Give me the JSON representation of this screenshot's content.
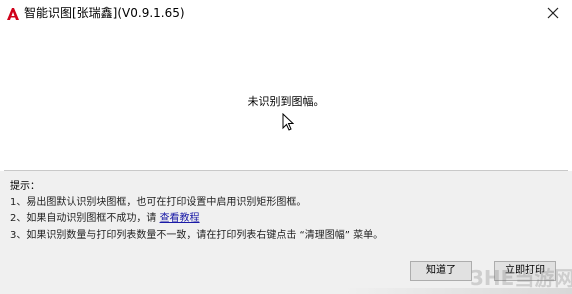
{
  "window": {
    "title": "智能识图[张瑞鑫](V0.9.1.65)",
    "icon": "autocad-logo-icon",
    "close_icon": "close-icon",
    "accent": "#d0021b"
  },
  "main": {
    "message": "未识别到图幅。"
  },
  "hints": {
    "title": "提示：",
    "line1": "1、易出图默认识别块图框，也可在打印设置中启用识别矩形图框。",
    "line2_prefix": "2、如果自动识别图框不成功，请",
    "line2_link": "查看教程",
    "line3": "3、如果识别数量与打印列表数量不一致，请在打印列表右键点击 “清理图幅” 菜单。"
  },
  "buttons": {
    "ok": "知道了",
    "print": "立即打印"
  },
  "watermark": "3HE当游网"
}
